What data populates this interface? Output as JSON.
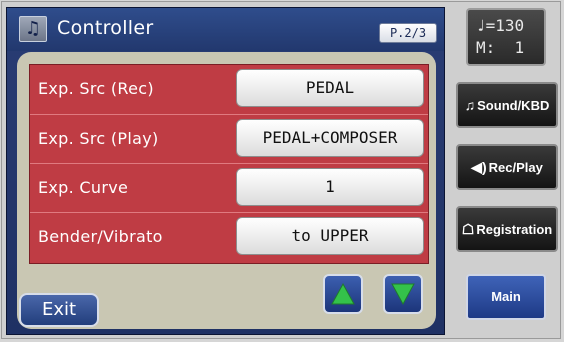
{
  "screen": {
    "title": "Controller",
    "title_icon": "music-notes-icon",
    "page": "P.2/3"
  },
  "rows": [
    {
      "label": "Exp. Src (Rec)",
      "value": "PEDAL"
    },
    {
      "label": "Exp. Src (Play)",
      "value": "PEDAL+COMPOSER"
    },
    {
      "label": "Exp. Curve",
      "value": "1"
    },
    {
      "label": "Bender/Vibrato",
      "value": "to UPPER"
    }
  ],
  "buttons": {
    "exit": "Exit",
    "up_icon": "up-arrow-icon",
    "down_icon": "down-arrow-icon"
  },
  "side": {
    "tempo_line": "♩=130",
    "measure_line": "M:  1",
    "sound_kbd": "Sound/KBD",
    "rec_play": "Rec/Play",
    "registration": "Registration",
    "main": "Main"
  },
  "colors": {
    "title_bar": "#22386e",
    "row_red": "#bf3c44",
    "arrow_green": "#34c24a",
    "content_bg": "#c9c7b3"
  }
}
